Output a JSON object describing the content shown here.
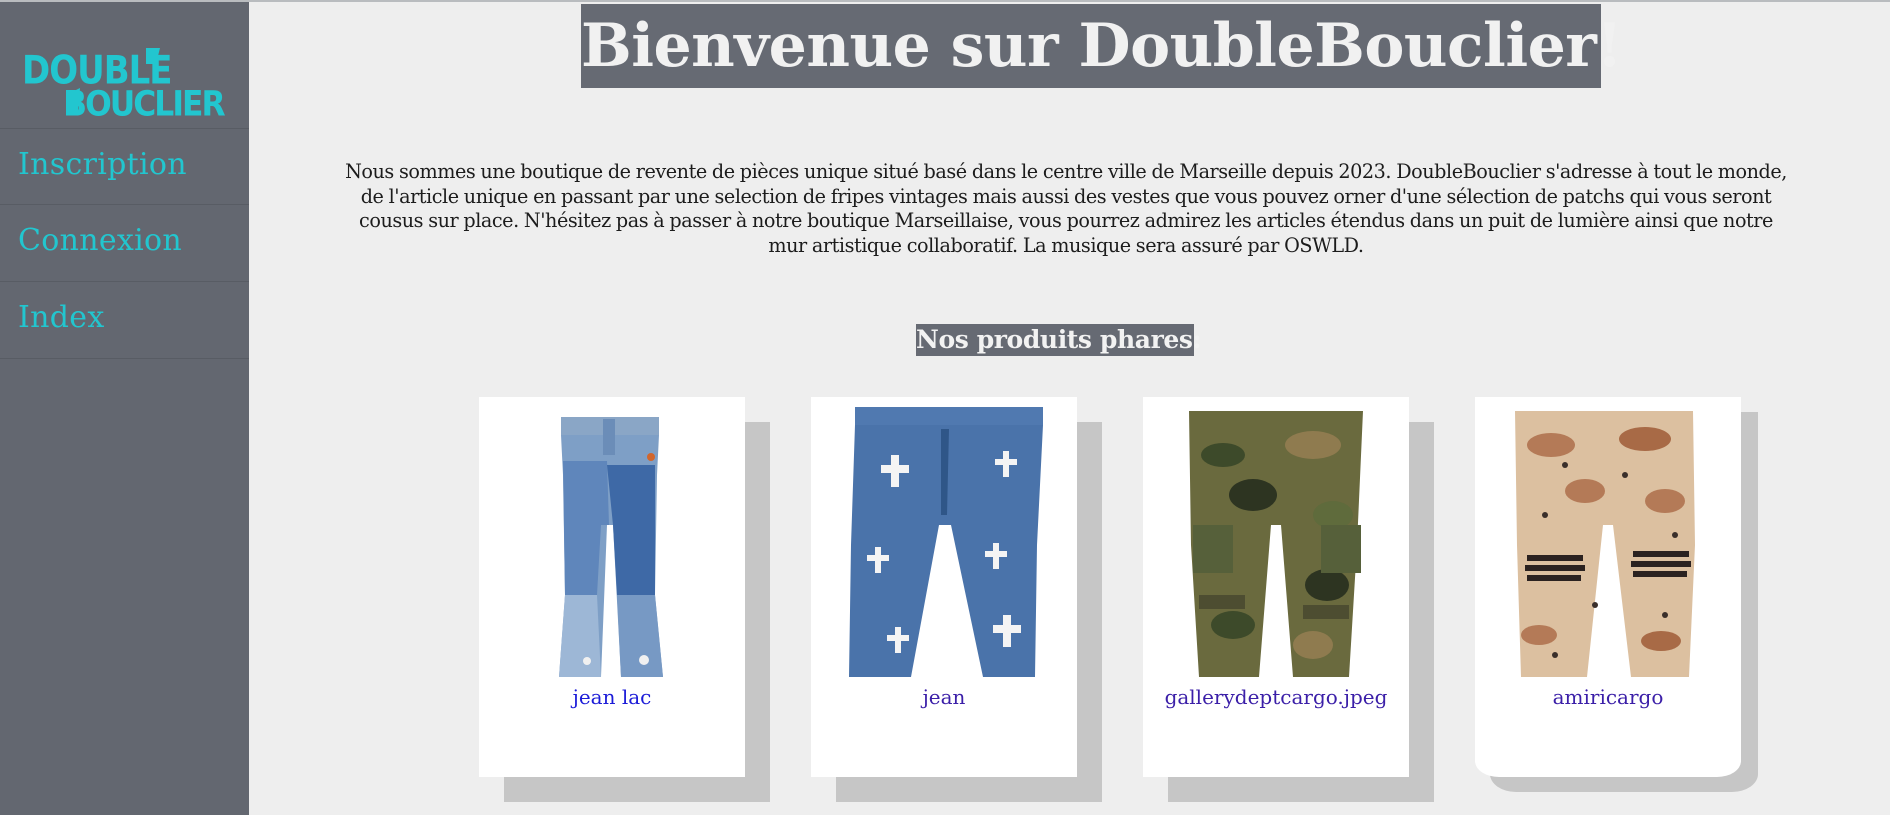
{
  "brand": {
    "logo_line1": "DOUBLE",
    "logo_line2": "BOUCLIER",
    "accent_color": "#22c6cf",
    "sidebar_color": "#636770"
  },
  "nav": {
    "items": [
      {
        "label": "Inscription"
      },
      {
        "label": "Connexion"
      },
      {
        "label": "Index"
      }
    ]
  },
  "main": {
    "title": "Bienvenue sur DoubleBouclier!",
    "intro": "Nous sommes une boutique de revente de pièces unique situé basé dans le centre ville de Marseille depuis 2023. DoubleBouclier s'adresse à tout le monde, de l'article unique en passant par une selection de fripes vintages mais aussi des vestes que vous pouvez orner d'une sélection de patchs qui vous seront cousus sur place. N'hésitez pas à passer à notre boutique Marseillaise, vous pourrez admirez les articles étendus dans un puit de lumière ainsi que notre mur artistique collaboratif. La musique sera assuré par OSWLD.",
    "products_heading": "Nos produits phares:"
  },
  "products": [
    {
      "label": "jean lac",
      "image": "patchwork-flared-jeans"
    },
    {
      "label": "jean",
      "image": "cross-patch-jeans"
    },
    {
      "label": "gallerydeptcargo.jpeg",
      "image": "camo-cargo-pants"
    },
    {
      "label": "amiricargo",
      "image": "desert-camo-ripped-pants"
    }
  ]
}
